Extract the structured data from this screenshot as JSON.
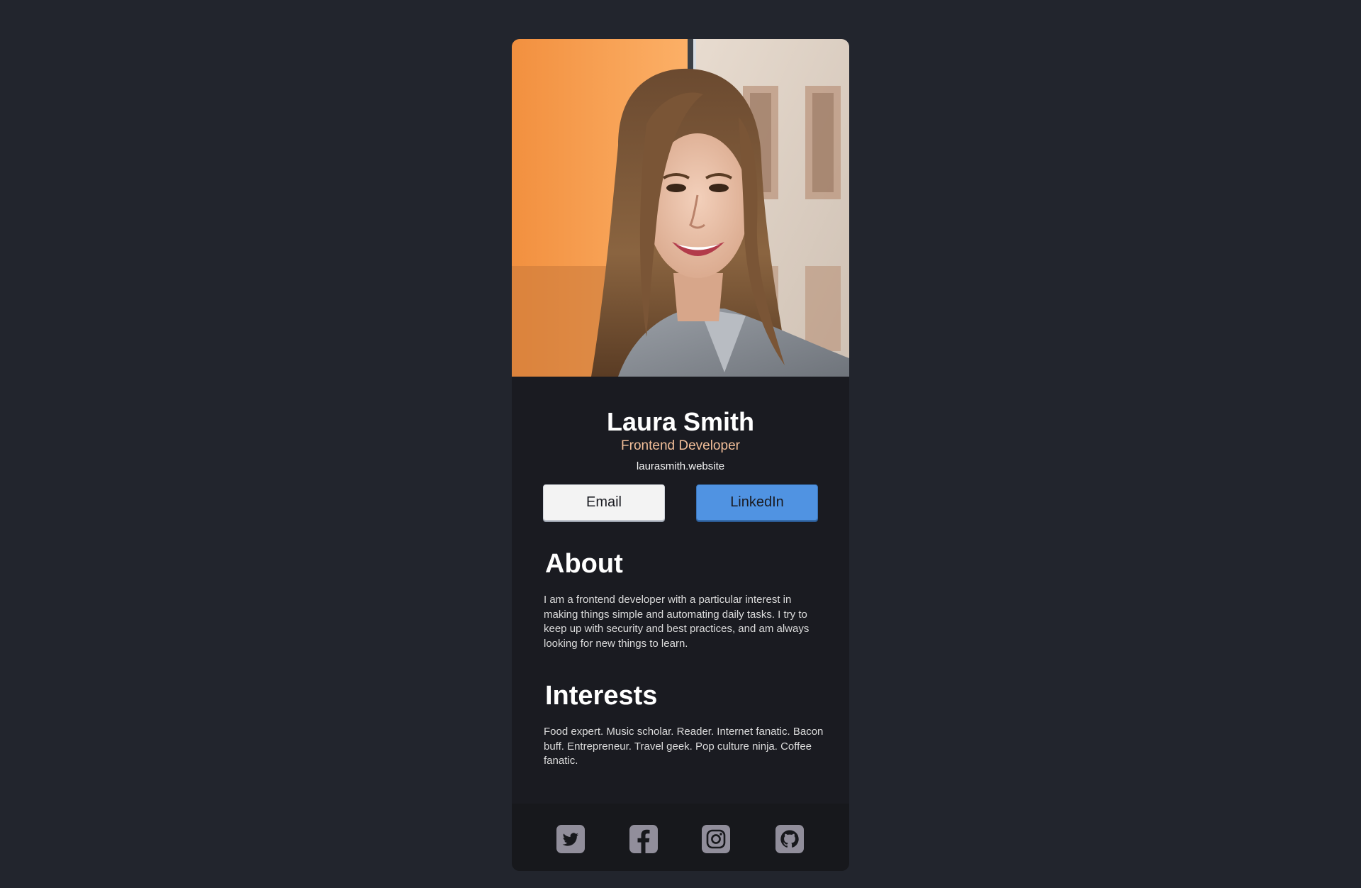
{
  "profile": {
    "name": "Laura Smith",
    "title": "Frontend Developer",
    "website": "laurasmith.website",
    "photo_alt": "Portrait photo of Laura Smith"
  },
  "buttons": {
    "email_label": "Email",
    "linkedin_label": "LinkedIn"
  },
  "about": {
    "heading": "About",
    "body": "I am a frontend developer with a particular interest in making things simple and automating daily tasks. I try to keep up with security and best practices, and am always looking for new things to learn."
  },
  "interests": {
    "heading": "Interests",
    "body": "Food expert. Music scholar. Reader. Internet fanatic. Bacon buff. Entrepreneur. Travel geek. Pop culture ninja. Coffee fanatic."
  },
  "footer": {
    "icons": [
      "twitter-icon",
      "facebook-icon",
      "instagram-icon",
      "github-icon"
    ]
  },
  "colors": {
    "page_background": "#22252d",
    "card_background": "#1a1b21",
    "footer_background": "#17181c",
    "title_accent": "#f3bf99",
    "linkedin_button": "#5093e2",
    "icon_fill": "#918e9b"
  }
}
